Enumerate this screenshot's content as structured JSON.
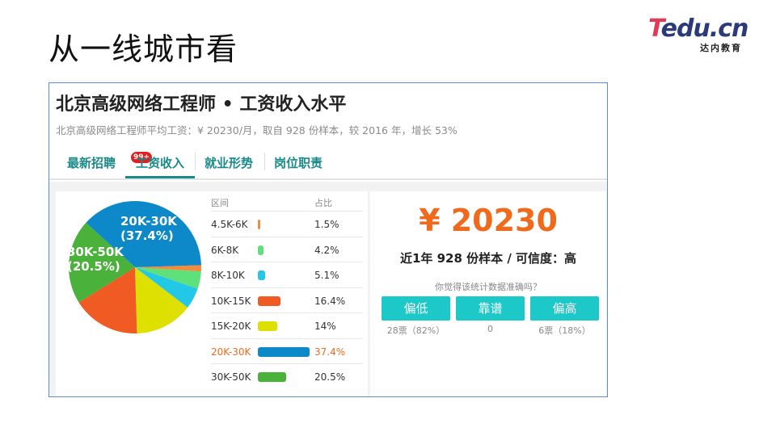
{
  "slide": {
    "title": "从一线城市看"
  },
  "logo": {
    "brand_t": "T",
    "brand_rest": "edu.cn",
    "subtitle": "达内教育"
  },
  "panel": {
    "title": "北京高级网络工程师 • 工资收入水平",
    "subtitle": "北京高级网络工程师平均工资：¥ 20230/月，取自 928 份样本，较 2016 年，增长 53%",
    "tabs": [
      {
        "label": "最新招聘",
        "badge": "99+"
      },
      {
        "label": "工资收入",
        "active": true
      },
      {
        "label": "就业形势"
      },
      {
        "label": "岗位职责"
      }
    ]
  },
  "pie_labels": {
    "l1": "20K-30K",
    "l1p": "(37.4%)",
    "l2": "30K-50K",
    "l2p": "(20.5%)"
  },
  "table": {
    "col_range": "区间",
    "col_pct": "占比",
    "rows": [
      {
        "range": "4.5K-6K",
        "pct": "1.5%",
        "value": 1.5,
        "color": "#f28b3b"
      },
      {
        "range": "6K-8K",
        "pct": "4.2%",
        "value": 4.2,
        "color": "#5ee07a"
      },
      {
        "range": "8K-10K",
        "pct": "5.1%",
        "value": 5.1,
        "color": "#22c8e6"
      },
      {
        "range": "10K-15K",
        "pct": "16.4%",
        "value": 16.4,
        "color": "#f05a23"
      },
      {
        "range": "15K-20K",
        "pct": "14%",
        "value": 14,
        "color": "#dde000"
      },
      {
        "range": "20K-30K",
        "pct": "37.4%",
        "value": 37.4,
        "color": "#0d88c8",
        "highlight": true
      },
      {
        "range": "30K-50K",
        "pct": "20.5%",
        "value": 20.5,
        "color": "#4ab13a"
      }
    ]
  },
  "summary": {
    "salary": "¥ 20230",
    "samples": "近1年 928 份样本 / 可信度：高",
    "question": "你觉得该统计数据准确吗？",
    "votes": [
      {
        "label": "偏低",
        "count": "28票（82%）"
      },
      {
        "label": "靠谱",
        "count": "0"
      },
      {
        "label": "偏高",
        "count": "6票（18%）"
      }
    ]
  },
  "chart_data": {
    "type": "pie",
    "categories": [
      "4.5K-6K",
      "6K-8K",
      "8K-10K",
      "10K-15K",
      "15K-20K",
      "20K-30K",
      "30K-50K"
    ],
    "values": [
      1.5,
      4.2,
      5.1,
      16.4,
      14,
      37.4,
      20.5
    ],
    "colors": [
      "#f28b3b",
      "#5ee07a",
      "#22c8e6",
      "#f05a23",
      "#dde000",
      "#0d88c8",
      "#4ab13a"
    ]
  }
}
